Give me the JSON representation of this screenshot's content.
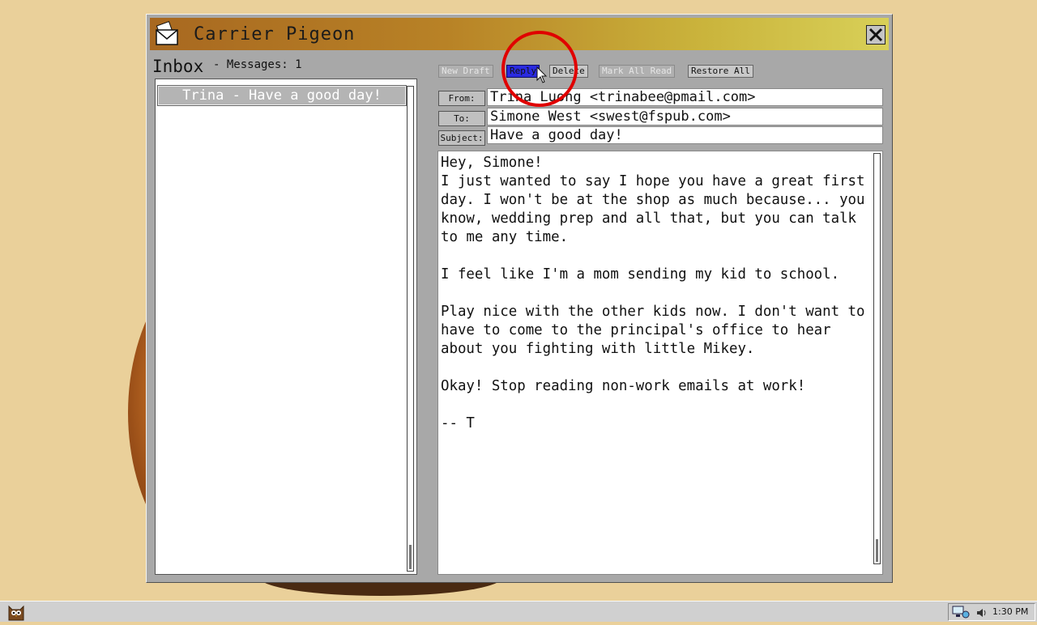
{
  "window": {
    "title": "Carrier Pigeon",
    "close_icon": "close-icon",
    "app_icon": "envelope-icon"
  },
  "inbox": {
    "label": "Inbox",
    "count_text": "- Messages: 1",
    "items": [
      {
        "label": "Trina - Have a good day!"
      }
    ]
  },
  "toolbar": {
    "new_draft": "New Draft",
    "reply": "Reply",
    "delete": "Delete",
    "mark_all_read": "Mark All Read",
    "restore_all": "Restore All"
  },
  "message": {
    "from_label": "From:",
    "to_label": "To:",
    "subject_label": "Subject:",
    "from": "Trina Luong <trinabee@pmail.com>",
    "to": "Simone West <swest@fspub.com>",
    "subject": "Have a good day!",
    "body": "Hey, Simone!\nI just wanted to say I hope you have a great first day. I won't be at the shop as much because... you know, wedding prep and all that, but you can talk to me any time.\n\nI feel like I'm a mom sending my kid to school.\n\nPlay nice with the other kids now. I don't want to have to come to the principal's office to hear about you fighting with little Mikey.\n\nOkay! Stop reading non-work emails at work!\n\n-- T"
  },
  "taskbar": {
    "clock": "1:30 PM",
    "start_icon": "owl-icon",
    "network_icon": "network-icon",
    "volume_icon": "volume-icon"
  },
  "colors": {
    "desktop": "#ead09a",
    "titlebar_start": "#a86820",
    "titlebar_end": "#d8d058",
    "reply_active": "#2a2ae0",
    "highlight_ring": "#e00000"
  }
}
